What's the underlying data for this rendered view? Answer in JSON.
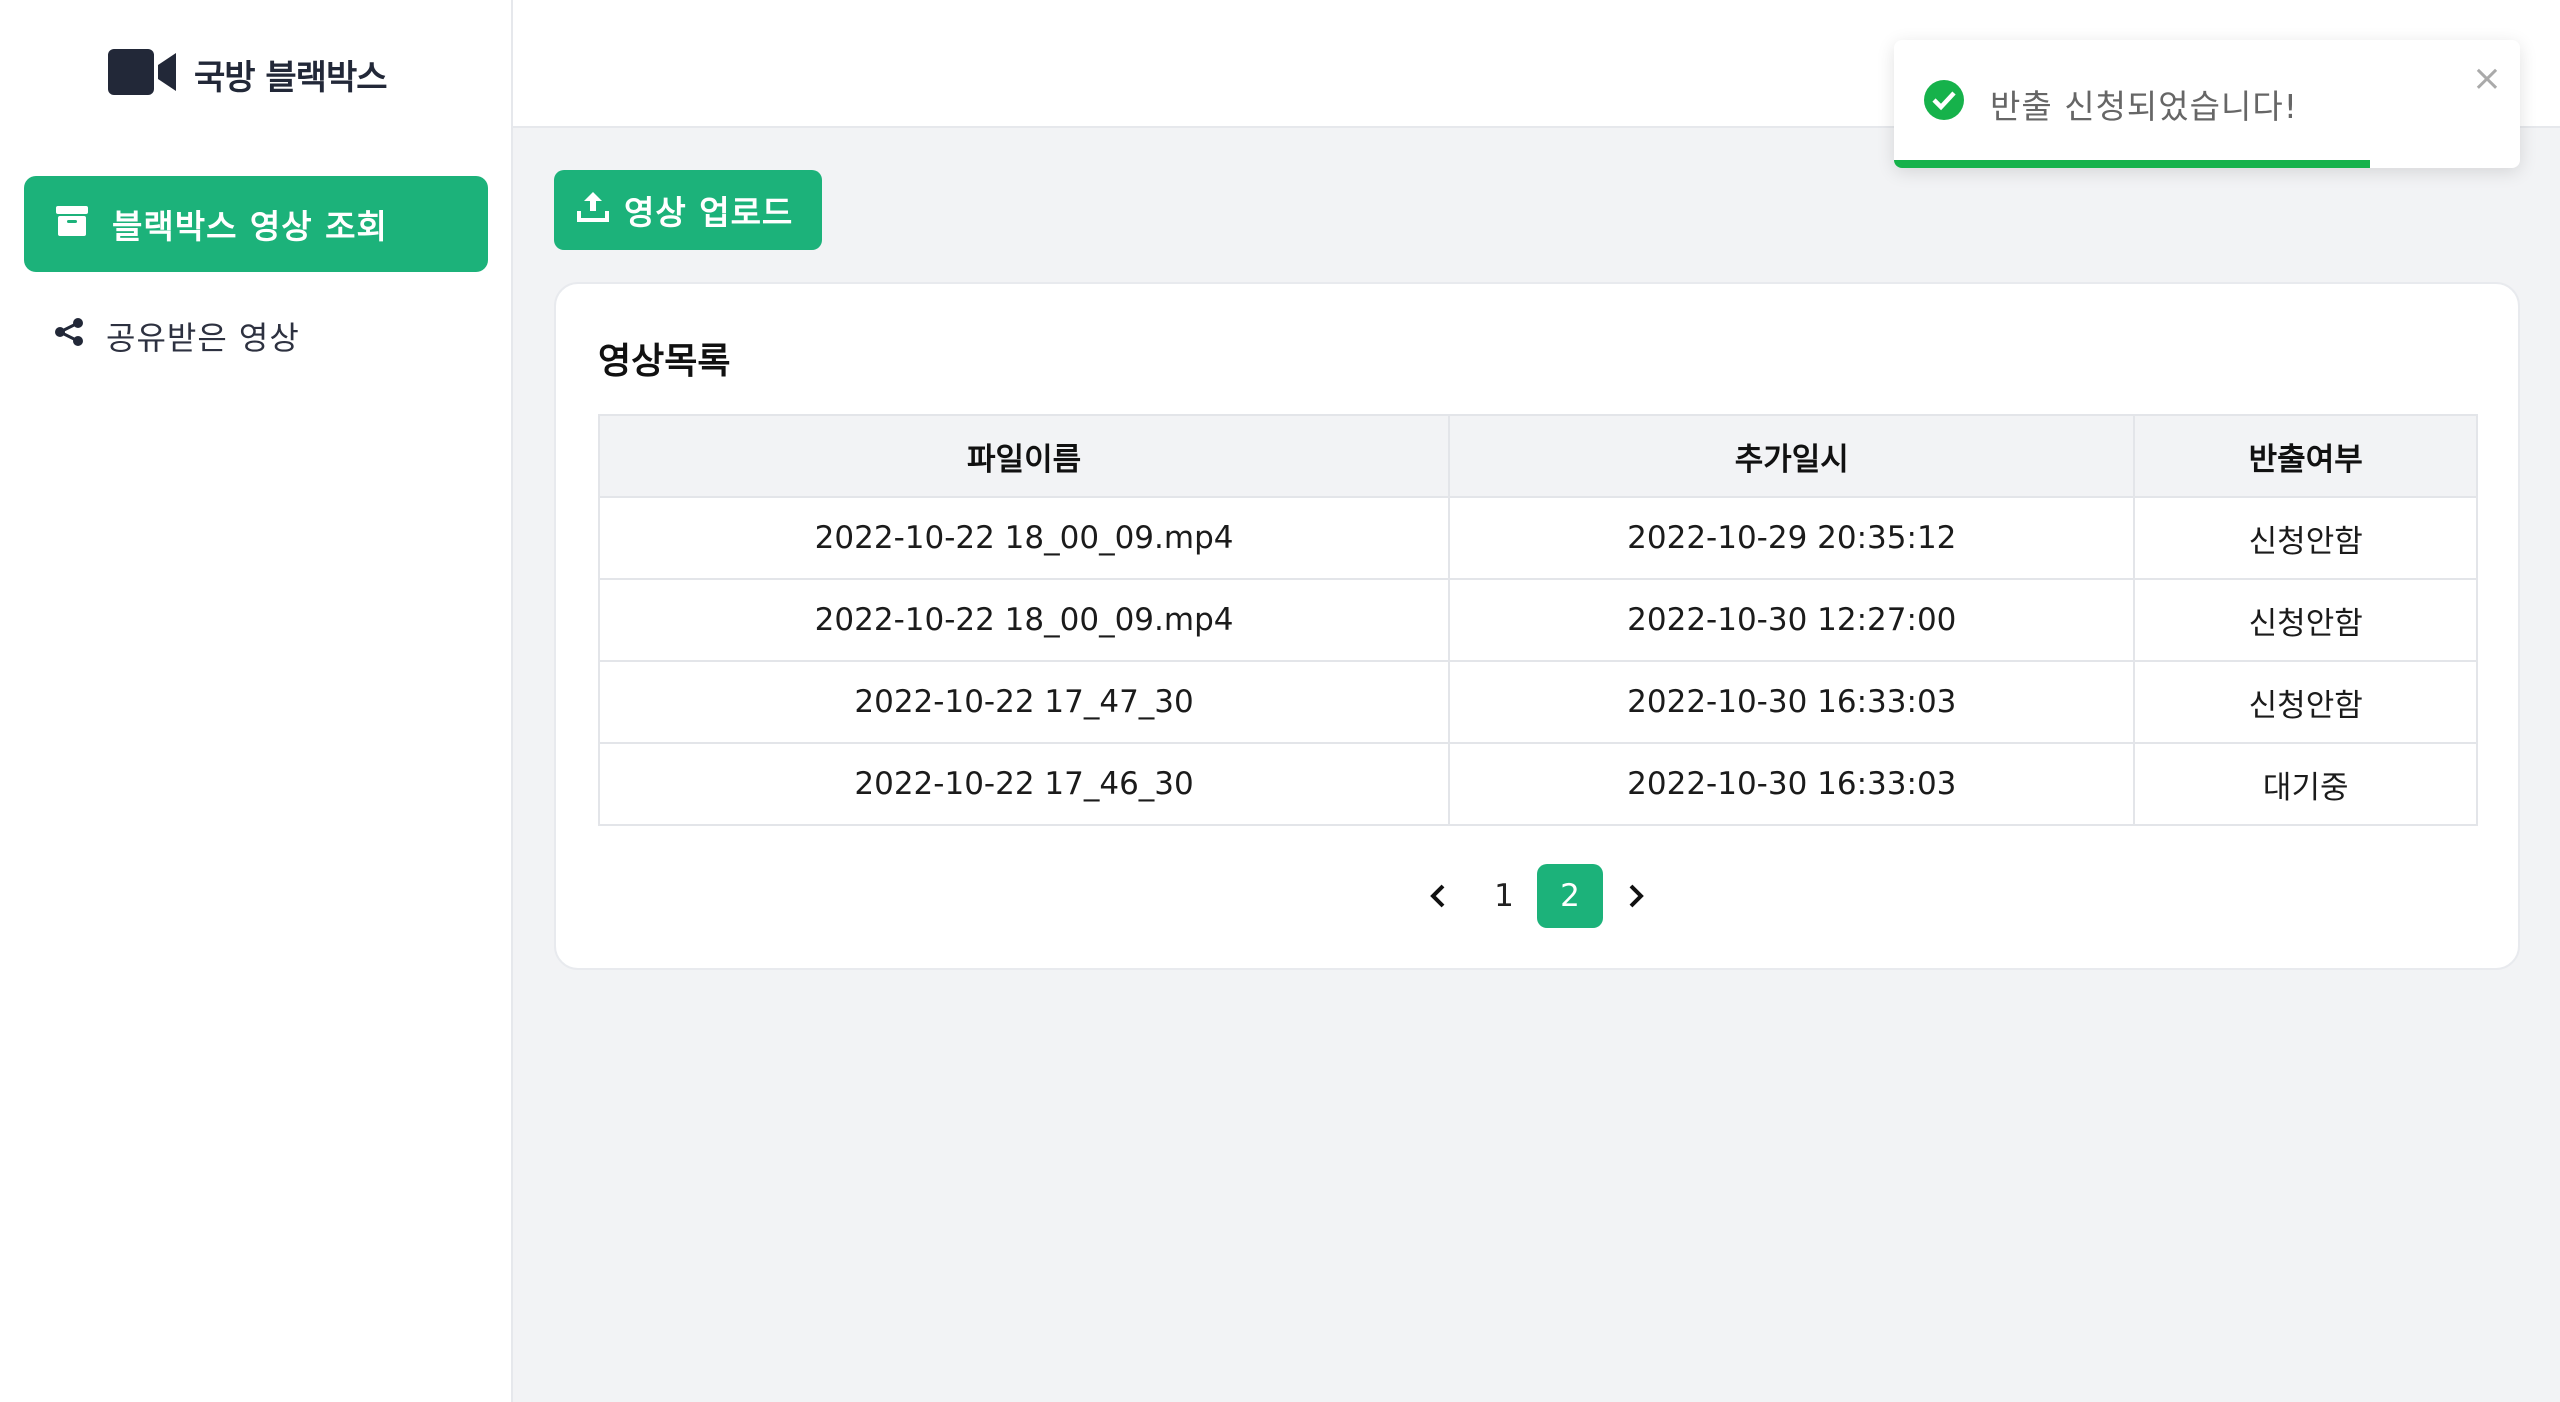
{
  "app": {
    "logo_text": "국방 블랙박스"
  },
  "sidebar": {
    "items": [
      {
        "label": "블랙박스 영상 조회",
        "icon": "archive-icon",
        "active": true
      },
      {
        "label": "공유받은 영상",
        "icon": "share-icon",
        "active": false
      }
    ]
  },
  "toolbar": {
    "upload_label": "영상 업로드",
    "upload_icon": "upload-icon"
  },
  "video_list": {
    "title": "영상목록",
    "columns": [
      "파일이름",
      "추가일시",
      "반출여부"
    ],
    "rows": [
      [
        "2022-10-22 18_00_09.mp4",
        "2022-10-29 20:35:12",
        "신청안함"
      ],
      [
        "2022-10-22 18_00_09.mp4",
        "2022-10-30 12:27:00",
        "신청안함"
      ],
      [
        "2022-10-22 17_47_30",
        "2022-10-30 16:33:03",
        "신청안함"
      ],
      [
        "2022-10-22 17_46_30",
        "2022-10-30 16:33:03",
        "대기중"
      ]
    ]
  },
  "pagination": {
    "prev": "‹",
    "next": "›",
    "pages": [
      "1",
      "2"
    ],
    "current": "2"
  },
  "toast": {
    "message": "반출 신청되었습니다!",
    "close": "×",
    "progress": 0.76,
    "icon": "check-circle-icon"
  },
  "colors": {
    "accent": "#1cb27a",
    "toast_success": "#16b24b",
    "background": "#f2f3f5"
  }
}
